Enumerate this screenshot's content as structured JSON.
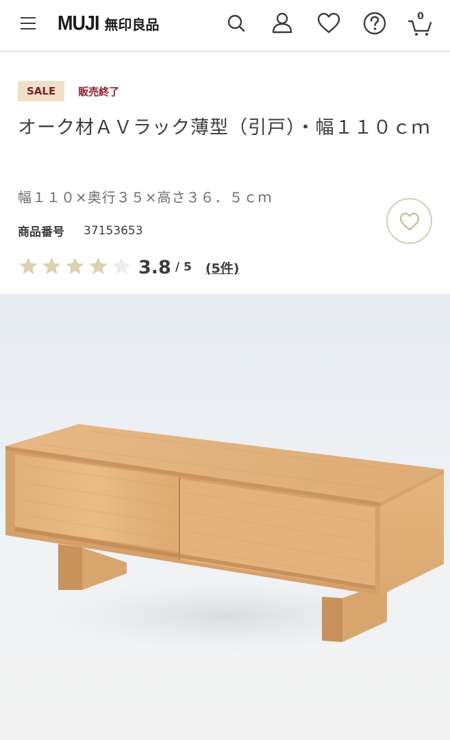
{
  "header": {
    "brand_latin": "MUJI",
    "brand_kanji": "無印良品",
    "cart_count": "0",
    "icons": [
      "menu-icon",
      "search-icon",
      "user-icon",
      "heart-icon",
      "help-icon",
      "cart-icon"
    ]
  },
  "product": {
    "sale_badge": "SALE",
    "status": "販売終了",
    "title": "オーク材ＡＶラック薄型（引戸）・幅１１０ｃｍ",
    "size": "幅１１０×奥行３５×高さ３６．５ｃｍ",
    "code_label": "商品番号",
    "code_value": "37153653",
    "rating": {
      "score": "3.8",
      "scale": "/ 5",
      "reviews": "(5件)",
      "stars_filled": 4,
      "stars_total": 5,
      "value": 3.8
    }
  },
  "colors": {
    "sale_badge_bg": "#efe0c8",
    "sale_text": "#7a1f2b",
    "star_filled": "#ddd0b3",
    "star_empty": "#ececec",
    "fav_border": "#d7ccb8"
  }
}
